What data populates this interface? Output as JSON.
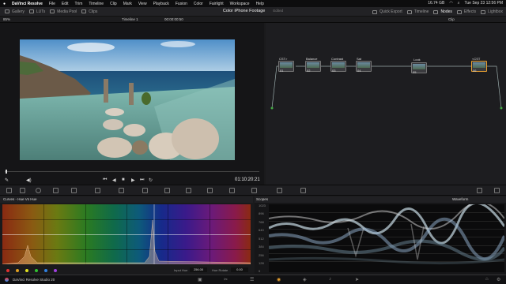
{
  "menubar": {
    "app": "DaVinci Resolve",
    "items": [
      "File",
      "Edit",
      "Trim",
      "Timeline",
      "Clip",
      "Mark",
      "View",
      "Playback",
      "Fusion",
      "Color",
      "Fairlight",
      "Workspace",
      "Help"
    ],
    "storage": "16.74 GB",
    "datetime": "Tue Sep 23  12:56 PM"
  },
  "toolbar": {
    "gallery": "Gallery",
    "luts": "LUTs",
    "media_pool": "Media Pool",
    "clips": "Clips",
    "project_title": "Color iPhone Footage",
    "edited": "Edited",
    "quick_export": "Quick Export",
    "timeline": "Timeline",
    "nodes": "Nodes",
    "effects": "Effects",
    "lightbox": "Lightbox"
  },
  "subbar": {
    "zoom": "85%",
    "timeline_name": "Timeline 1",
    "timecode_top": "00:00:00:50",
    "clip_label": "Clip"
  },
  "nodes": [
    {
      "num": "01",
      "label": "CST>"
    },
    {
      "num": "02",
      "label": "Balance"
    },
    {
      "num": "03",
      "label": "Contrast"
    },
    {
      "num": "04",
      "label": "Sat"
    },
    {
      "num": "05",
      "label": "Look"
    },
    {
      "num": "06",
      "label": "<CST"
    }
  ],
  "transport": {
    "timecode": "01:10:20:21"
  },
  "curves": {
    "title": "Curves - Hue Vs Hue",
    "input_hue_label": "Input Hue",
    "input_hue_value": "256.00",
    "hue_rotate_label": "Hue Rotate",
    "hue_rotate_value": "0.00",
    "swatch_colors": [
      "#e03030",
      "#e0a020",
      "#e0e020",
      "#30c030",
      "#3080e0",
      "#a040e0"
    ]
  },
  "scopes": {
    "title": "Scopes",
    "mode": "Waveform",
    "scale": [
      "1023",
      "896",
      "768",
      "640",
      "512",
      "384",
      "256",
      "128",
      "0"
    ]
  },
  "bottom": {
    "product": "DaVinci Resolve Studio 20"
  }
}
